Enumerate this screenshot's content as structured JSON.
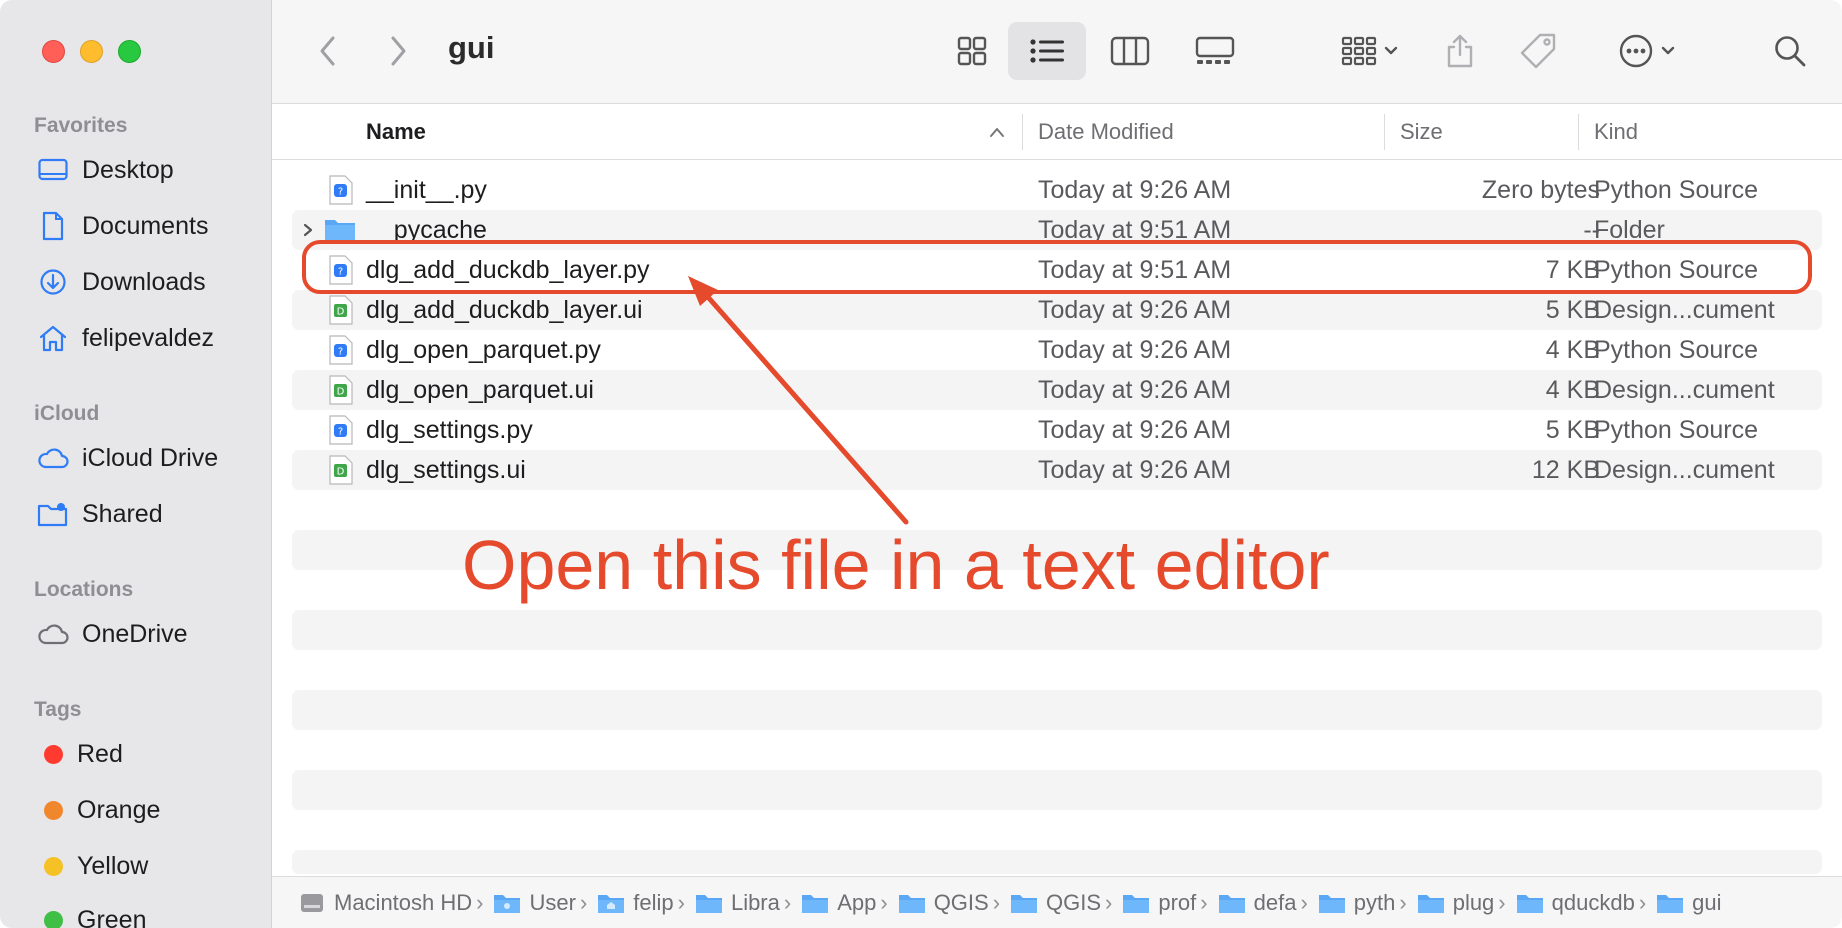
{
  "window": {
    "title": "gui"
  },
  "sidebar": {
    "sections": [
      {
        "label": "Favorites",
        "items": [
          {
            "label": "Desktop",
            "icon": "desktop-icon"
          },
          {
            "label": "Documents",
            "icon": "document-icon"
          },
          {
            "label": "Downloads",
            "icon": "download-icon"
          },
          {
            "label": "felipevaldez",
            "icon": "home-icon"
          }
        ]
      },
      {
        "label": "iCloud",
        "items": [
          {
            "label": "iCloud Drive",
            "icon": "cloud-icon"
          },
          {
            "label": "Shared",
            "icon": "shared-folder-icon"
          }
        ]
      },
      {
        "label": "Locations",
        "items": [
          {
            "label": "OneDrive",
            "icon": "cloud-icon"
          }
        ]
      },
      {
        "label": "Tags",
        "items": [
          {
            "label": "Red",
            "color": "#ff3b30"
          },
          {
            "label": "Orange",
            "color": "#f0872d"
          },
          {
            "label": "Yellow",
            "color": "#f6c124"
          },
          {
            "label": "Green",
            "color": "#3fbf46"
          }
        ]
      }
    ]
  },
  "columns": {
    "name": "Name",
    "date": "Date Modified",
    "size": "Size",
    "kind": "Kind"
  },
  "files": [
    {
      "name": "__init__.py",
      "date": "Today at 9:26 AM",
      "size": "Zero bytes",
      "kind": "Python Source",
      "type": "py"
    },
    {
      "name": "__pycache__",
      "date": "Today at 9:51 AM",
      "size": "--",
      "kind": "Folder",
      "type": "folder"
    },
    {
      "name": "dlg_add_duckdb_layer.py",
      "date": "Today at 9:51 AM",
      "size": "7 KB",
      "kind": "Python Source",
      "type": "py"
    },
    {
      "name": "dlg_add_duckdb_layer.ui",
      "date": "Today at 9:26 AM",
      "size": "5 KB",
      "kind": "Design...cument",
      "type": "ui"
    },
    {
      "name": "dlg_open_parquet.py",
      "date": "Today at 9:26 AM",
      "size": "4 KB",
      "kind": "Python Source",
      "type": "py"
    },
    {
      "name": "dlg_open_parquet.ui",
      "date": "Today at 9:26 AM",
      "size": "4 KB",
      "kind": "Design...cument",
      "type": "ui"
    },
    {
      "name": "dlg_settings.py",
      "date": "Today at 9:26 AM",
      "size": "5 KB",
      "kind": "Python Source",
      "type": "py"
    },
    {
      "name": "dlg_settings.ui",
      "date": "Today at 9:26 AM",
      "size": "12 KB",
      "kind": "Design...cument",
      "type": "ui"
    }
  ],
  "annotation": {
    "text": "Open this file in a text editor",
    "color": "#e54a2c"
  },
  "pathbar": [
    {
      "label": "Macintosh HD",
      "icon": "disk-icon"
    },
    {
      "label": "User",
      "icon": "folder-icon"
    },
    {
      "label": "felip",
      "icon": "home-folder-icon"
    },
    {
      "label": "Libra",
      "icon": "folder-icon"
    },
    {
      "label": "App",
      "icon": "folder-icon"
    },
    {
      "label": "QGIS",
      "icon": "folder-icon"
    },
    {
      "label": "QGIS",
      "icon": "folder-icon"
    },
    {
      "label": "prof",
      "icon": "folder-icon"
    },
    {
      "label": "defa",
      "icon": "folder-icon"
    },
    {
      "label": "pyth",
      "icon": "folder-icon"
    },
    {
      "label": "plug",
      "icon": "folder-icon"
    },
    {
      "label": "qduckdb",
      "icon": "folder-icon"
    },
    {
      "label": "gui",
      "icon": "folder-icon"
    }
  ]
}
